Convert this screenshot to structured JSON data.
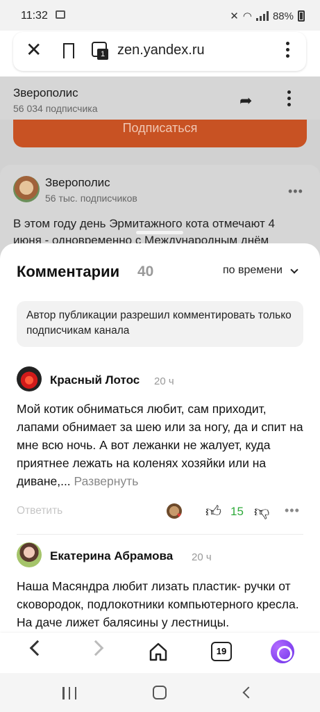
{
  "status_bar": {
    "time": "11:32",
    "battery": "88%"
  },
  "browser": {
    "url": "zen.yandex.ru",
    "tab_count": "1"
  },
  "channel_header": {
    "name": "Зверополис",
    "subscribers": "56 034 подписчика"
  },
  "subscribe_button": "Подписаться",
  "post": {
    "author": "Зверополис",
    "subscribers": "56 тыс. подписчиков",
    "text": "В этом году день Эрмитажного кота отмечают 4 июня - одновременно с Международным днём"
  },
  "comments_panel": {
    "title": "Комментарии",
    "count": "40",
    "sort_label": "по времени",
    "notice": "Автор публикации разрешил комментировать только подписчикам канала"
  },
  "comments": [
    {
      "author": "Красный Лотос",
      "time": "20 ч",
      "text": "Мой котик обниматься любит, сам приходит, лапами обнимает за шею или за ногу, да и спит на мне всю ночь. А вот лежанки не жалует, куда приятнее лежать на коленях хозяйки или на диване,...",
      "expand_label": "Развернуть",
      "reply_label": "Ответить",
      "likes": "15"
    },
    {
      "author": "Екатерина Абрамова",
      "time": "20 ч",
      "text": "Наша Масяндра любит лизать пластик- ручки от сковородок, подлокотники компьютерного кресла. На даче лижет балясины у лестницы."
    }
  ],
  "bottom_nav": {
    "tabs_count": "19"
  },
  "colors": {
    "subscribe": "#c85223",
    "likes": "#2eaa3a",
    "alice": "#7b3ff2"
  }
}
